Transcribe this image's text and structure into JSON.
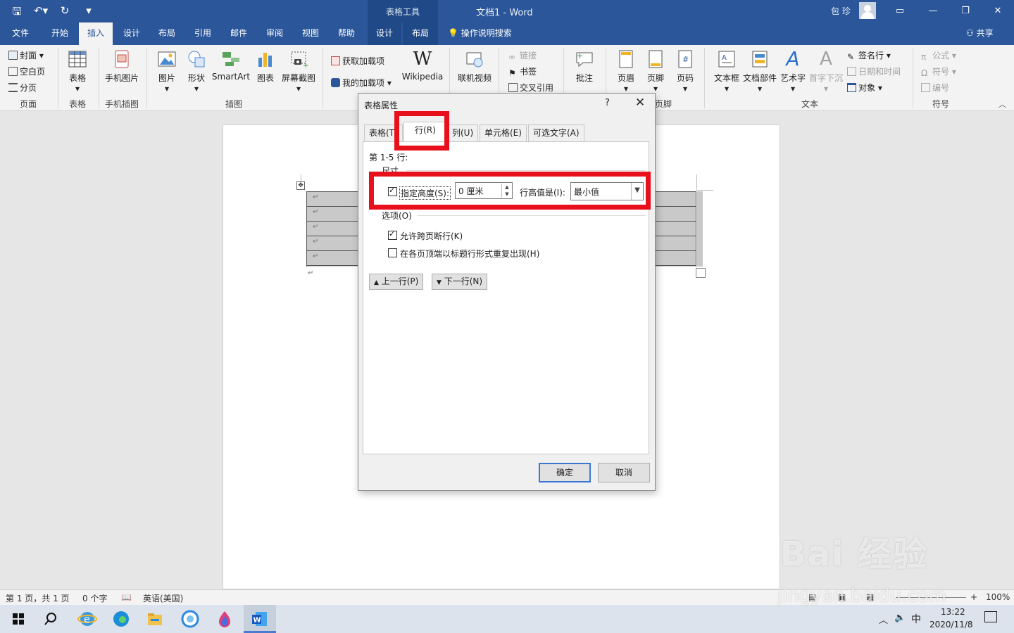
{
  "titlebar": {
    "qat_icons": [
      "save-icon",
      "undo-icon",
      "redo-icon",
      "customize-icon"
    ],
    "context_title": "表格工具",
    "doc_title": "文档1  -  Word",
    "user_name": "包 珍",
    "window_buttons": [
      "▭",
      "—",
      "❐",
      "✕"
    ]
  },
  "tabs": [
    "文件",
    "开始",
    "插入",
    "设计",
    "布局",
    "引用",
    "邮件",
    "审阅",
    "视图",
    "帮助",
    "设计",
    "布局"
  ],
  "active_tab": "插入",
  "search_label": "操作说明搜索",
  "share_label": "共享",
  "ribbon": {
    "pages": {
      "cover": "封面",
      "blank": "空白页",
      "break": "分页",
      "label": "页面"
    },
    "tables": {
      "table": "表格",
      "label": "表格"
    },
    "phone": {
      "pic": "手机图片",
      "label": "手机插图"
    },
    "illus": {
      "picture": "图片",
      "shapes": "形状",
      "smartart": "SmartArt",
      "chart": "图表",
      "screenshot": "屏幕截图",
      "label": "插图"
    },
    "addins": {
      "get": "获取加载项",
      "my": "我的加载项",
      "wiki_logo": "W",
      "wiki": "Wikipedia"
    },
    "media": {
      "video": "联机视频"
    },
    "links": {
      "link": "链接",
      "bookmark": "书签",
      "crossref": "交叉引用"
    },
    "comments": {
      "comment": "批注"
    },
    "headerfooter": {
      "header": "页眉",
      "footer": "页脚",
      "pagenum": "页码",
      "label": "页脚"
    },
    "text": {
      "textbox": "文本框",
      "quickparts": "文档部件",
      "wordart": "艺术字",
      "dropcap": "首字下沉",
      "signature": "签名行",
      "datetime": "日期和时间",
      "object": "对象",
      "label": "文本"
    },
    "symbols": {
      "equation": "公式",
      "symbol": "符号",
      "number": "编号",
      "label": "符号"
    }
  },
  "dialog": {
    "title": "表格属性",
    "help": "?",
    "close": "✕",
    "tabs": [
      "表格(T)",
      "行(R)",
      "列(U)",
      "单元格(E)",
      "可选文字(A)"
    ],
    "active_tab": "行(R)",
    "rows_label": "第 1-5 行:",
    "size_label": "尺寸",
    "specify_height_label": "指定高度(S):",
    "specify_height_checked": true,
    "height_value": "0 厘米",
    "rule_label": "行高值是(I):",
    "rule_value": "最小值",
    "options_label": "选项(O)",
    "allow_break_label": "允许跨页断行(K)",
    "allow_break_checked": true,
    "repeat_header_label": "在各页顶端以标题行形式重复出现(H)",
    "repeat_header_checked": false,
    "prev_row": "上一行(P)",
    "next_row": "下一行(N)",
    "ok": "确定",
    "cancel": "取消"
  },
  "statusbar": {
    "page": "第 1 页，共 1 页",
    "words": "0 个字",
    "language": "英语(美国)",
    "zoom": "100%"
  },
  "taskbar": {
    "icons": [
      "windows-start-icon",
      "search-icon",
      "ie-icon",
      "edge-icon",
      "file-explorer-icon",
      "browser-icon",
      "photos-icon",
      "word-icon"
    ],
    "ime": "中",
    "time": "13:22",
    "date": "2020/11/8"
  },
  "colors": {
    "accent": "#2b579a",
    "highlight": "#e8101a"
  },
  "watermark": {
    "line1": "Bai 经验",
    "line2": "jingyan.baidu.com"
  }
}
